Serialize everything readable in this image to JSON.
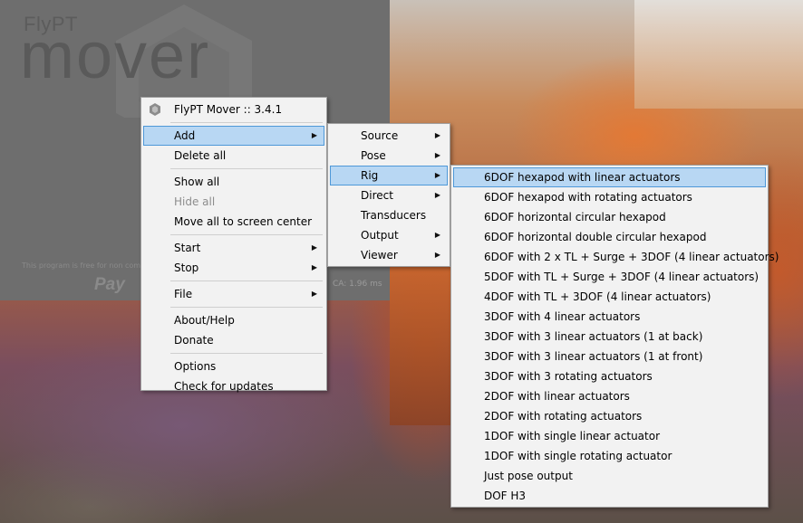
{
  "app": {
    "logo_small": "FlyPT",
    "logo_large": "mover",
    "free_note": "This program is free for non comm",
    "paypal_text": "Pay",
    "ca_readout": "CA: 1.96 ms"
  },
  "icons": {
    "header_icon": "flypt-hexagon-icon",
    "submenu_arrow": "chevron-right-icon"
  },
  "colors": {
    "menu_background": "#f2f2f2",
    "highlight_fill": "#b8d7f3",
    "highlight_border": "#4e98d8",
    "disabled_text": "#8d8d8d"
  },
  "main_menu": {
    "header": "FlyPT Mover :: 3.4.1",
    "add": "Add",
    "delete_all": "Delete all",
    "show_all": "Show all",
    "hide_all": "Hide all",
    "move_all": "Move all to screen center",
    "start": "Start",
    "stop": "Stop",
    "file": "File",
    "about": "About/Help",
    "donate": "Donate",
    "options": "Options",
    "check_updates": "Check for updates"
  },
  "add_menu": {
    "source": "Source",
    "pose": "Pose",
    "rig": "Rig",
    "direct": "Direct",
    "transducers": "Transducers",
    "output": "Output",
    "viewer": "Viewer"
  },
  "rig_menu": [
    "6DOF hexapod with linear actuators",
    "6DOF hexapod with rotating actuators",
    "6DOF horizontal circular hexapod",
    "6DOF horizontal double circular hexapod",
    "6DOF with 2 x TL + Surge + 3DOF (4 linear actuators)",
    "5DOF with TL + Surge + 3DOF (4 linear actuators)",
    "4DOF with TL + 3DOF (4 linear actuators)",
    "3DOF with 4 linear actuators",
    "3DOF with 3 linear actuators (1 at back)",
    "3DOF with 3 linear actuators (1 at front)",
    "3DOF with 3 rotating actuators",
    "2DOF with linear actuators",
    "2DOF with rotating actuators",
    "1DOF with single linear actuator",
    "1DOF with single rotating actuator",
    "Just pose output",
    "DOF H3"
  ]
}
